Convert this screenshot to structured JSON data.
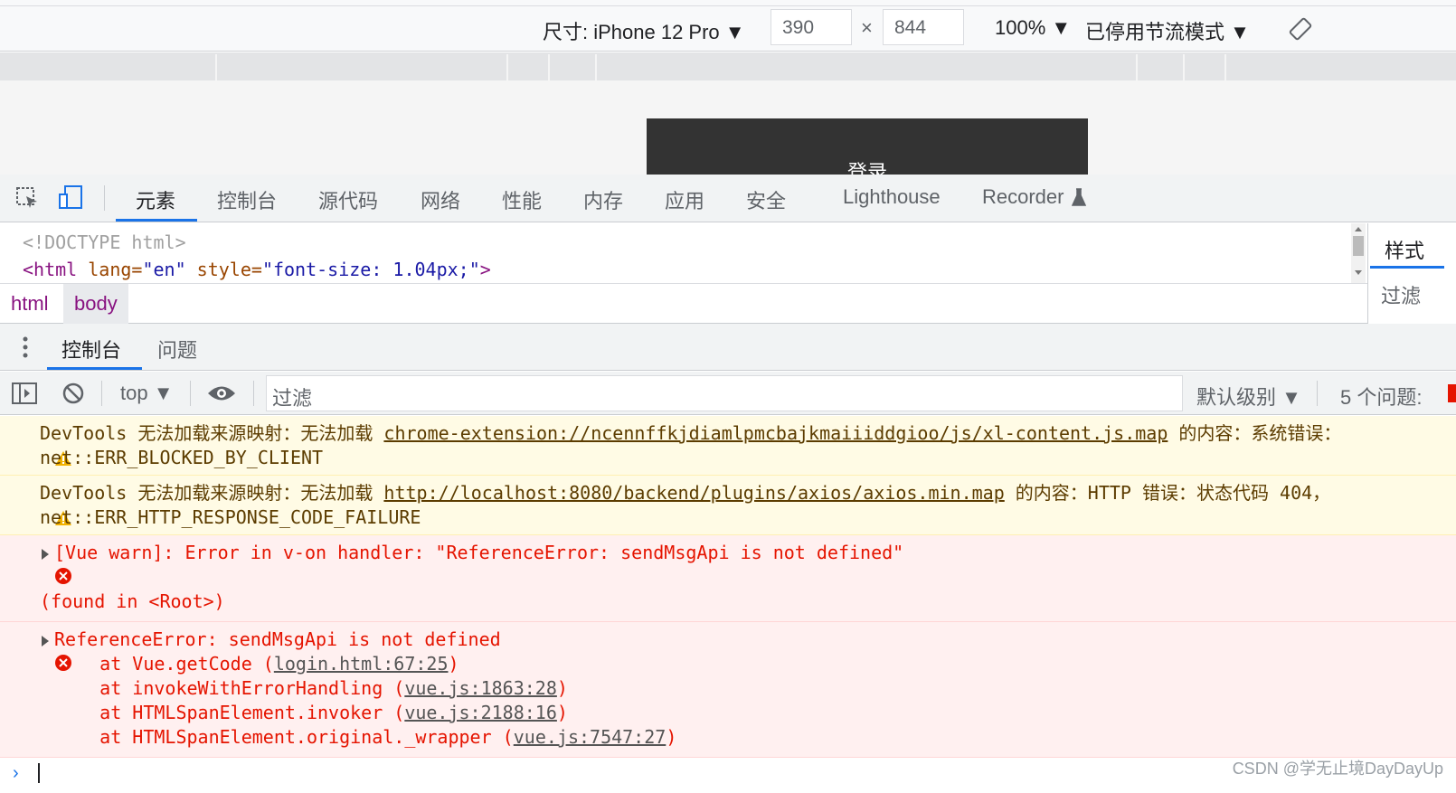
{
  "device_toolbar": {
    "size_label": "尺寸: iPhone 12 Pro ▼",
    "width": "390",
    "times": "×",
    "height": "844",
    "zoom": "100% ▼",
    "throttling": "已停用节流模式 ▼"
  },
  "preview": {
    "login_button": "登录"
  },
  "devtools_tabs": [
    "元素",
    "控制台",
    "源代码",
    "网络",
    "性能",
    "内存",
    "应用",
    "安全",
    "Lighthouse",
    "Recorder"
  ],
  "elements": {
    "doctype": "<!DOCTYPE html>",
    "html_open": "<html",
    "attr_lang": " lang=",
    "val_lang": "\"en\"",
    "attr_style": " style=",
    "val_style": "\"font-size: 1.04px;\"",
    "close": ">"
  },
  "breadcrumb": [
    "html",
    "body"
  ],
  "styles_pane": {
    "tab": "样式",
    "filter": "过滤"
  },
  "drawer_tabs": [
    "控制台",
    "问题"
  ],
  "console_toolbar": {
    "context": "top ▼",
    "filter_placeholder": "过滤",
    "levels": "默认级别 ▼",
    "issues": "5 个问题:"
  },
  "messages": [
    {
      "type": "warning",
      "line1_prefix": "DevTools 无法加载来源映射：无法加载 ",
      "line1_link": "chrome-extension://ncennffkjdiamlpmcbajkmaiiiddgioo/js/xl-content.js.map",
      "line1_suffix": " 的内容：系统错误：",
      "line2": "net::ERR_BLOCKED_BY_CLIENT"
    },
    {
      "type": "warning",
      "line1_prefix": "DevTools 无法加载来源映射：无法加载 ",
      "line1_link": "http://localhost:8080/backend/plugins/axios/axios.min.map",
      "line1_suffix": " 的内容：HTTP 错误：状态代码 404，",
      "line2": "net::ERR_HTTP_RESPONSE_CODE_FAILURE"
    },
    {
      "type": "error",
      "line1": "[Vue warn]: Error in v-on handler: \"ReferenceError: sendMsgApi is not defined\"",
      "line3": "(found in <Root>)"
    },
    {
      "type": "error",
      "line1": "ReferenceError: sendMsgApi is not defined",
      "stack": [
        {
          "prefix": "    at Vue.getCode (",
          "link": "login.html:67:25",
          "suffix": ")"
        },
        {
          "prefix": "    at invokeWithErrorHandling (",
          "link": "vue.js:1863:28",
          "suffix": ")"
        },
        {
          "prefix": "    at HTMLSpanElement.invoker (",
          "link": "vue.js:2188:16",
          "suffix": ")"
        },
        {
          "prefix": "    at HTMLSpanElement.original._wrapper (",
          "link": "vue.js:7547:27",
          "suffix": ")"
        }
      ]
    }
  ],
  "watermark": "CSDN @学无止境DayDayUp",
  "colors": {
    "accent": "#1a73e8",
    "error": "#e51400",
    "warning_bg": "#fffbe5",
    "error_bg": "#fff0f0"
  }
}
